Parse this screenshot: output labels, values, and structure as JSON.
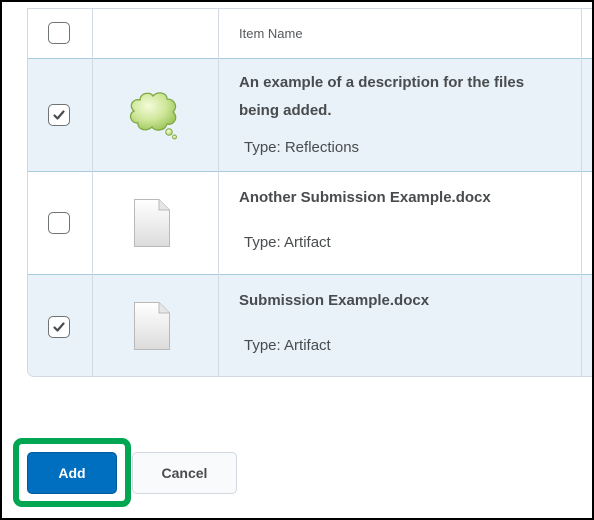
{
  "table": {
    "header": {
      "item_name": "Item Name"
    },
    "rows": [
      {
        "title_line1": "An example of a description for the files",
        "title_line2": "being added.",
        "type": "Type: Reflections",
        "checked": true,
        "icon": "thought-bubble-icon"
      },
      {
        "title_line1": "Another Submission Example.docx",
        "type": "Type: Artifact",
        "checked": false,
        "icon": "document-icon"
      },
      {
        "title_line1": "Submission Example.docx",
        "type": "Type: Artifact",
        "checked": true,
        "icon": "document-icon"
      }
    ]
  },
  "buttons": {
    "add": "Add",
    "cancel": "Cancel"
  },
  "colors": {
    "primary": "#006fbf",
    "selected_row": "#e8f2f8",
    "highlight": "#00a651"
  }
}
